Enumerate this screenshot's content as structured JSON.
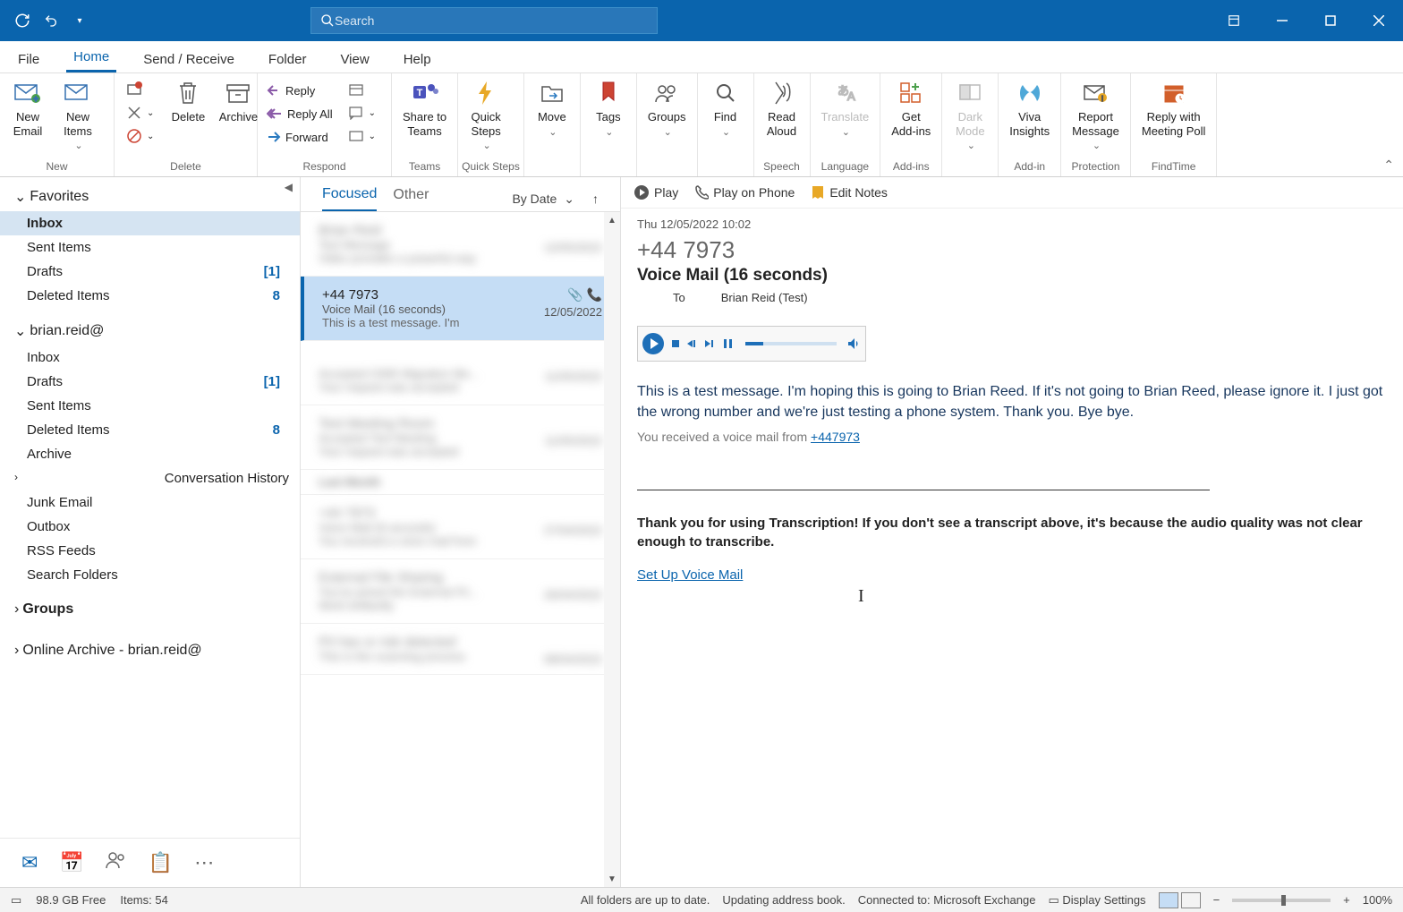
{
  "title_bar": {
    "search_placeholder": "Search"
  },
  "menu": [
    "File",
    "Home",
    "Send / Receive",
    "Folder",
    "View",
    "Help"
  ],
  "menu_active": 1,
  "ribbon": {
    "new_email": "New\nEmail",
    "new_items": "New\nItems",
    "delete": "Delete",
    "archive": "Archive",
    "reply": "Reply",
    "reply_all": "Reply All",
    "forward": "Forward",
    "share_teams": "Share to\nTeams",
    "quick_steps": "Quick\nSteps",
    "move": "Move",
    "tags": "Tags",
    "groups": "Groups",
    "find": "Find",
    "read_aloud": "Read\nAloud",
    "translate": "Translate",
    "get_addins": "Get\nAdd-ins",
    "dark_mode": "Dark\nMode",
    "viva": "Viva\nInsights",
    "report_msg": "Report\nMessage",
    "meeting_poll": "Reply with\nMeeting Poll",
    "grp_new": "New",
    "grp_delete": "Delete",
    "grp_respond": "Respond",
    "grp_teams": "Teams",
    "grp_quick": "Quick Steps",
    "grp_speech": "Speech",
    "grp_lang": "Language",
    "grp_addins": "Add-ins",
    "grp_addin": "Add-in",
    "grp_protect": "Protection",
    "grp_findtime": "FindTime"
  },
  "nav": {
    "favorites_label": "Favorites",
    "favorites": [
      {
        "label": "Inbox",
        "selected": true
      },
      {
        "label": "Sent Items"
      },
      {
        "label": "Drafts",
        "count": "[1]"
      },
      {
        "label": "Deleted Items",
        "count": "8"
      }
    ],
    "account_label": "brian.reid@",
    "account": [
      {
        "label": "Inbox"
      },
      {
        "label": "Drafts",
        "count": "[1]"
      },
      {
        "label": "Sent Items"
      },
      {
        "label": "Deleted Items",
        "count": "8"
      },
      {
        "label": "Archive"
      },
      {
        "label": "Conversation History",
        "expandable": true
      },
      {
        "label": "Junk Email"
      },
      {
        "label": "Outbox"
      },
      {
        "label": "RSS Feeds"
      },
      {
        "label": "Search Folders"
      }
    ],
    "groups_label": "Groups",
    "archive_label": "Online Archive - brian.reid@"
  },
  "msglist": {
    "tab_focused": "Focused",
    "tab_other": "Other",
    "sort": "By Date",
    "selected": {
      "from": "+44 7973",
      "subject": "Voice Mail (16 seconds)",
      "preview": "This is a test message. I'm",
      "date": "12/05/2022"
    }
  },
  "reading": {
    "act_play": "Play",
    "act_play_phone": "Play on Phone",
    "act_edit": "Edit Notes",
    "timestamp": "Thu 12/05/2022 10:02",
    "caller": "+44 7973",
    "subject": "Voice Mail (16 seconds)",
    "to_label": "To",
    "to_value": "Brian Reid (Test)",
    "transcript": "This is a test message. I'm hoping this is going to Brian Reed. If it's not going to Brian Reed, please ignore it. I just got the wrong number and we're just testing a phone system. Thank you. Bye bye.",
    "vm_prefix": "You received a voice mail from ",
    "vm_number": "+447973",
    "note": "Thank you for using Transcription! If you don't see a transcript above, it's because the audio quality was not clear enough to transcribe.",
    "setup_link": "Set Up Voice Mail"
  },
  "status": {
    "free": "98.9 GB Free",
    "items": "Items: 54",
    "uptodate": "All folders are up to date.",
    "updating": "Updating address book.",
    "connected": "Connected to: Microsoft Exchange",
    "display": "Display Settings",
    "zoom": "100%"
  }
}
